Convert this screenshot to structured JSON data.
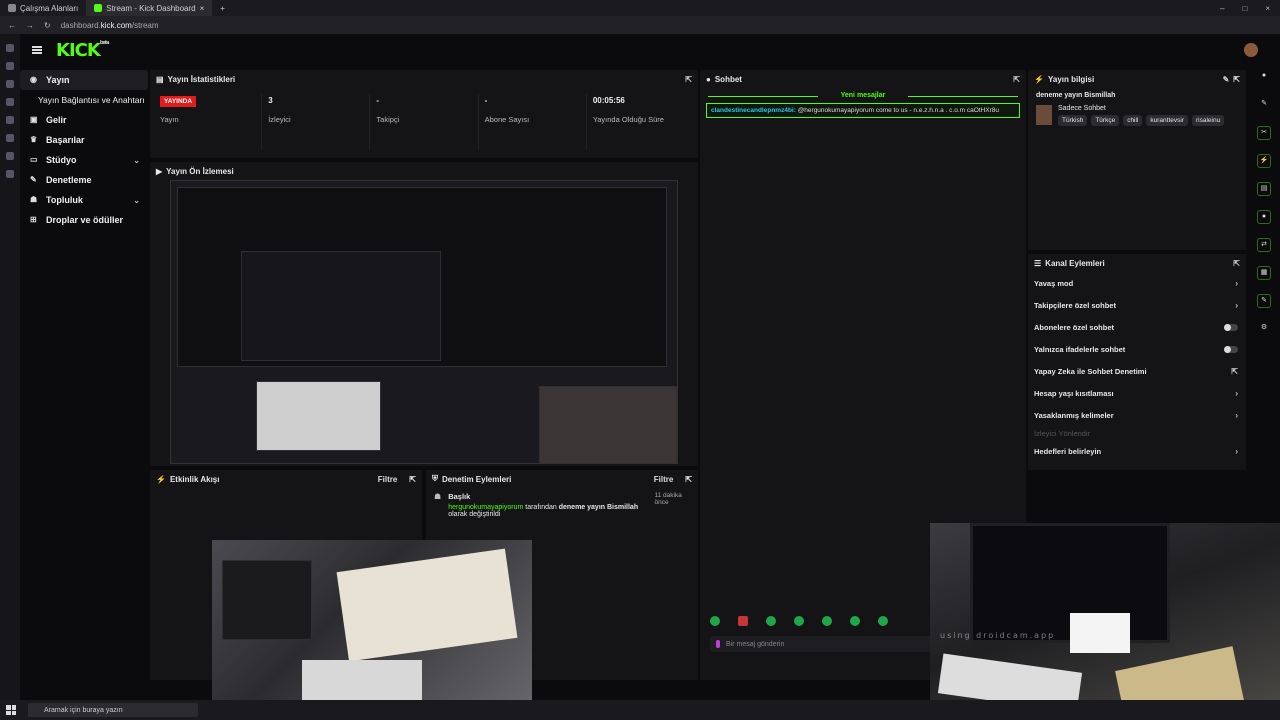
{
  "browser": {
    "tabs": [
      {
        "label": "Çalışma Alanları"
      },
      {
        "label": "Stream - Kick Dashboard"
      }
    ],
    "url_domain": "dashboard.",
    "url_bold": "kick.com",
    "url_path": "/stream"
  },
  "app": {
    "logo": "KICK",
    "logo_sup": "beta"
  },
  "nav": {
    "items": [
      {
        "label": "Yayın",
        "icon": "broadcast-icon"
      },
      {
        "label": "Yayın Bağlantısı ve Anahtarı",
        "icon": ""
      },
      {
        "label": "Gelir",
        "icon": "dollar-icon"
      },
      {
        "label": "Başarılar",
        "icon": "trophy-icon"
      },
      {
        "label": "Stüdyo",
        "icon": "camera-icon"
      },
      {
        "label": "Denetleme",
        "icon": "wrench-icon"
      },
      {
        "label": "Topluluk",
        "icon": "people-icon"
      },
      {
        "label": "Droplar ve ödüller",
        "icon": "gift-icon"
      }
    ]
  },
  "stats": {
    "title": "Yayın İstatistikleri",
    "live_badge": "YAYINDA",
    "items": [
      {
        "value": "",
        "label": "Yayın"
      },
      {
        "value": "3",
        "label": "İzleyici"
      },
      {
        "value": "-",
        "label": "Takipçi"
      },
      {
        "value": "-",
        "label": "Abone Sayısı"
      },
      {
        "value": "00:05:56",
        "label": "Yayında Olduğu Süre"
      }
    ]
  },
  "preview": {
    "title": "Yayın Ön İzlemesi"
  },
  "activity": {
    "title": "Etkinlik Akışı",
    "filter": "Filtre"
  },
  "moderation": {
    "title": "Denetim Eylemleri",
    "filter": "Filtre",
    "entry": {
      "heading": "Başlık",
      "ago": "11 dakika önce",
      "user": "hergunokumayapiyorum",
      "mid": " tarafından ",
      "bold": "deneme yayın Bismillah",
      "tail": " olarak değiştirildi"
    }
  },
  "chat": {
    "title": "Sohbet",
    "new_messages": "Yeni mesajlar",
    "message_user": "clandestinecandlepnmz4bi:",
    "message_text": " @hergunokumayapiyorum come to us - n.e.z.h.n.a . c.o.m caOtHXr8u",
    "input_placeholder": "Bir mesaj gönderin"
  },
  "info": {
    "title": "Yayın bilgisi",
    "stream_title": "deneme yayın Bismillah",
    "category": "Sadece Sohbet",
    "tags": [
      "Türkish",
      "Türkçe",
      "chill",
      "kuranttevsir",
      "risaleinu"
    ]
  },
  "channel_actions": {
    "title": "Kanal Eylemleri",
    "items": [
      {
        "label": "Yavaş mod",
        "control": "chevron"
      },
      {
        "label": "Takipçilere özel sohbet",
        "control": "chevron"
      },
      {
        "label": "Abonelere özel sohbet",
        "control": "toggle"
      },
      {
        "label": "Yalnızca ifadelerle sohbet",
        "control": "toggle"
      },
      {
        "label": "Yapay Zeka ile Sohbet Denetimi",
        "control": "external"
      },
      {
        "label": "Hesap yaşı kısıtlaması",
        "control": "chevron"
      },
      {
        "label": "Yasaklanmış kelimeler",
        "control": "chevron"
      },
      {
        "label": "İzleyici Yönlendir",
        "control": "disabled"
      },
      {
        "label": "Hedefleri belirleyin",
        "control": "chevron"
      }
    ]
  },
  "camera": {
    "watermark": "using droidcam.app"
  },
  "taskbar": {
    "search_placeholder": "Aramak için buraya yazın"
  },
  "colors": {
    "accent": "#53fc18",
    "live": "#e01c1c",
    "panel": "#141417",
    "background": "#0b0b0d"
  }
}
